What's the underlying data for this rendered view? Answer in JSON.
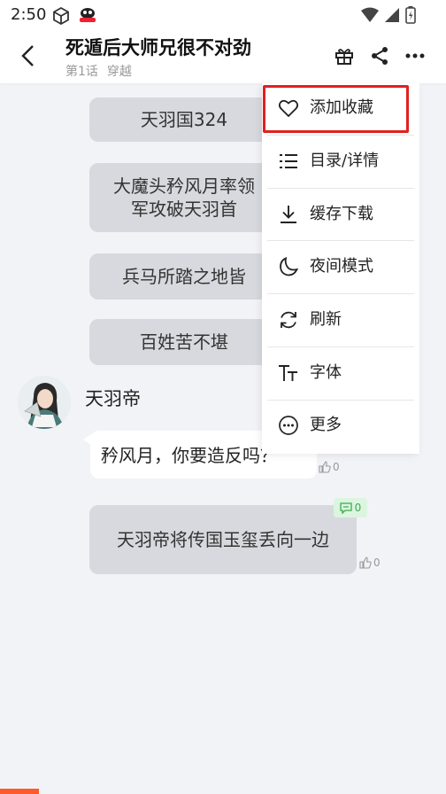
{
  "status_bar": {
    "time": "2:50"
  },
  "header": {
    "title": "死遁后大师兄很不对劲",
    "chapter": "第1话",
    "tag": "穿越"
  },
  "chat": {
    "narrations": [
      "天羽国324",
      "大魔头矜风月率领\n军攻破天羽首",
      "兵马所踏之地皆",
      "百姓苦不堪"
    ],
    "speaker_name": "天羽帝",
    "speaker_line": "矜风月，你要造反吗？",
    "speaker_likes": "0",
    "final_narration": "天羽帝将传国玉玺丢向一边",
    "final_comments": "0",
    "final_likes": "0"
  },
  "menu": {
    "items": [
      {
        "label": "添加收藏",
        "icon": "heart-icon"
      },
      {
        "label": "目录/详情",
        "icon": "list-icon"
      },
      {
        "label": "缓存下载",
        "icon": "download-icon"
      },
      {
        "label": "夜间模式",
        "icon": "moon-icon"
      },
      {
        "label": "刷新",
        "icon": "refresh-icon"
      },
      {
        "label": "字体",
        "icon": "font-icon"
      },
      {
        "label": "更多",
        "icon": "more-circle-icon"
      }
    ]
  },
  "colors": {
    "highlight": "#e02020",
    "comment_badge": "#3bab4f",
    "accent_bar": "#ff5a2c"
  }
}
